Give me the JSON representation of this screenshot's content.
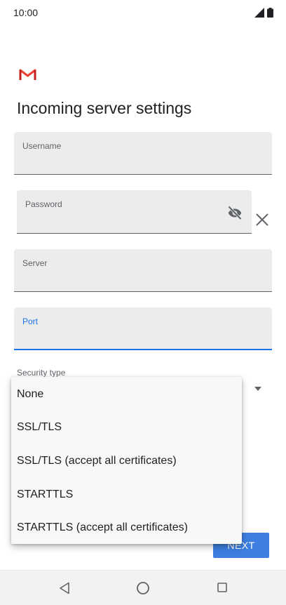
{
  "status": {
    "time": "10:00"
  },
  "app": {
    "logo": "gmail-logo",
    "brand_colors": [
      "#ea4335",
      "#c5221f"
    ]
  },
  "page": {
    "title": "Incoming server settings"
  },
  "fields": {
    "username": {
      "label": "Username",
      "value": ""
    },
    "password": {
      "label": "Password",
      "value": ""
    },
    "server": {
      "label": "Server",
      "value": ""
    },
    "port": {
      "label": "Port",
      "value": "",
      "focused": true
    }
  },
  "security": {
    "label": "Security type",
    "options": [
      "None",
      "SSL/TLS",
      "SSL/TLS (accept all certificates)",
      "STARTTLS",
      "STARTTLS (accept all certificates)"
    ]
  },
  "actions": {
    "next_label": "NEXT"
  },
  "colors": {
    "accent": "#1a73e8",
    "button": "#3d7fe0"
  },
  "icons": [
    "signal-icon",
    "battery-icon",
    "visibility-off-icon",
    "close-icon",
    "dropdown-arrow-icon",
    "back-icon",
    "home-icon",
    "recents-icon"
  ]
}
